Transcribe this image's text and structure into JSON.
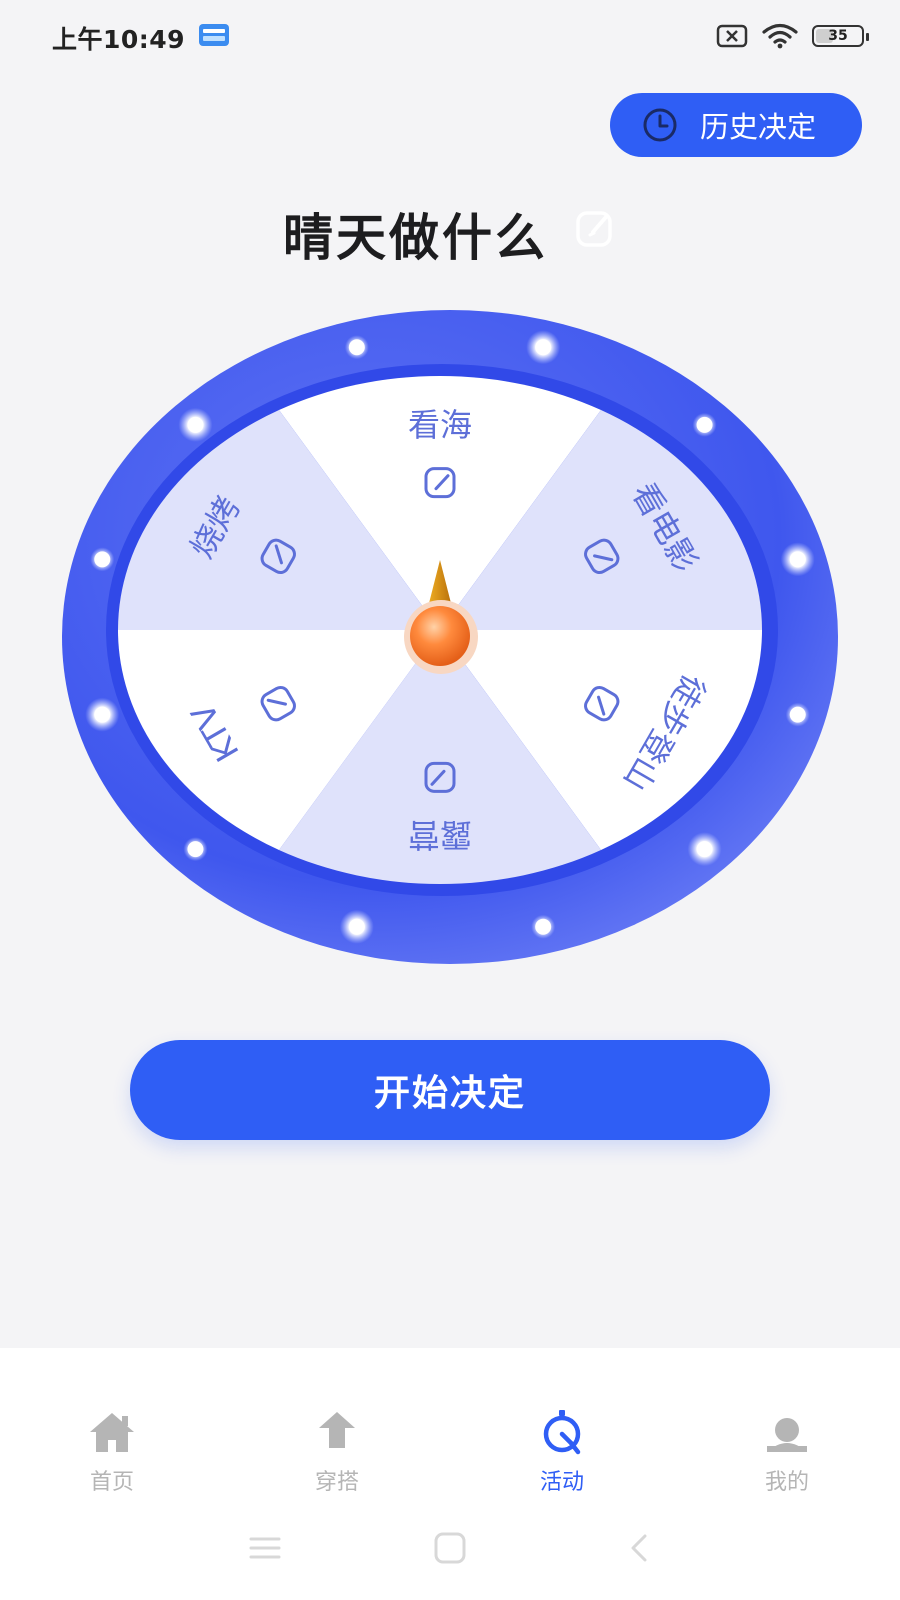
{
  "status_bar": {
    "time": "上午10:49",
    "battery": "35"
  },
  "header": {
    "history_label": "历史决定"
  },
  "title": "晴天做什么",
  "wheel": {
    "segments": [
      "看海",
      "看电影",
      "徒步登山",
      "露营",
      "KTV",
      "烧烤"
    ],
    "colors": {
      "ring": "#3d54ee",
      "light": "#dfe2fb",
      "white": "#ffffff",
      "text": "#5d6fd8"
    }
  },
  "start_label": "开始决定",
  "nav": [
    {
      "label": "首页",
      "icon": "home-icon",
      "active": false
    },
    {
      "label": "穿搭",
      "icon": "shirt-icon",
      "active": false
    },
    {
      "label": "活动",
      "icon": "activity-icon",
      "active": true
    },
    {
      "label": "我的",
      "icon": "profile-icon",
      "active": false
    }
  ],
  "colors": {
    "accent": "#2f5ef5",
    "inactive": "#b5b5b5",
    "background": "#f4f4f6"
  }
}
